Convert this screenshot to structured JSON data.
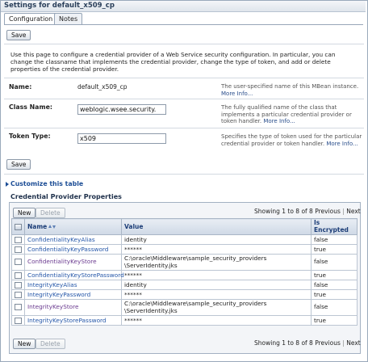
{
  "window": {
    "title": "Settings for default_x509_cp"
  },
  "tabs": [
    {
      "label": "Configuration",
      "active": true
    },
    {
      "label": "Notes",
      "active": false
    }
  ],
  "save_label": "Save",
  "intro": "Use this page to configure a credential provider of a Web Service security configuration. In particular, you can change the classname that implements the credential provider, change the type of token, and add or delete properties of the credential provider.",
  "fields": {
    "name": {
      "label": "Name:",
      "value": "default_x509_cp",
      "help": "The user-specified name of this MBean instance.",
      "more": "More Info..."
    },
    "class_name": {
      "label": "Class Name:",
      "value": "weblogic.wsee.security.",
      "help": "The fully qualified name of the class that implements a particular credential provider or token handler.",
      "more": "More Info..."
    },
    "token_type": {
      "label": "Token Type:",
      "value": "x509",
      "help": "Specifies the type of token used for the particular credential provider or token handler.",
      "more": "More Info..."
    }
  },
  "customize_label": "Customize this table",
  "table_title": "Credential Provider Properties",
  "toolbar": {
    "new_label": "New",
    "delete_label": "Delete"
  },
  "pager": {
    "showing": "Showing 1 to 8 of 8",
    "previous": "Previous",
    "separator": "|",
    "next": "Next"
  },
  "columns": {
    "name": "Name",
    "value": "Value",
    "encrypted": "Is Encrypted"
  },
  "rows": [
    {
      "name": "ConfidentialityKeyAlias",
      "value": "identity",
      "encrypted": "false"
    },
    {
      "name": "ConfidentialityKeyPassword",
      "value": "******",
      "encrypted": "true"
    },
    {
      "name": "ConfidentialityKeyStore",
      "value": "C:\\oracle\\Middleware\\sample_security_providers\\ServerIdentity.jks",
      "value_line1": "C:\\oracle\\Middleware\\sample_security_providers",
      "value_line2": "\\ServerIdentity.jks",
      "encrypted": "false"
    },
    {
      "name": "ConfidentialityKeyStorePassword",
      "value": "******",
      "encrypted": "true"
    },
    {
      "name": "IntegrityKeyAlias",
      "value": "identity",
      "encrypted": "false"
    },
    {
      "name": "IntegrityKeyPassword",
      "value": "******",
      "encrypted": "true"
    },
    {
      "name": "IntegrityKeyStore",
      "value": "C:\\oracle\\Middleware\\sample_security_providers\\ServerIdentity.jks",
      "value_line1": "C:\\oracle\\Middleware\\sample_security_providers",
      "value_line2": "\\ServerIdentity.jks",
      "encrypted": "false"
    },
    {
      "name": "IntegrityKeyStorePassword",
      "value": "******",
      "encrypted": "true"
    }
  ],
  "colors": {
    "link": "#2456a8",
    "visited_link": "#6a3a8f",
    "header_text": "#1d3e78"
  }
}
